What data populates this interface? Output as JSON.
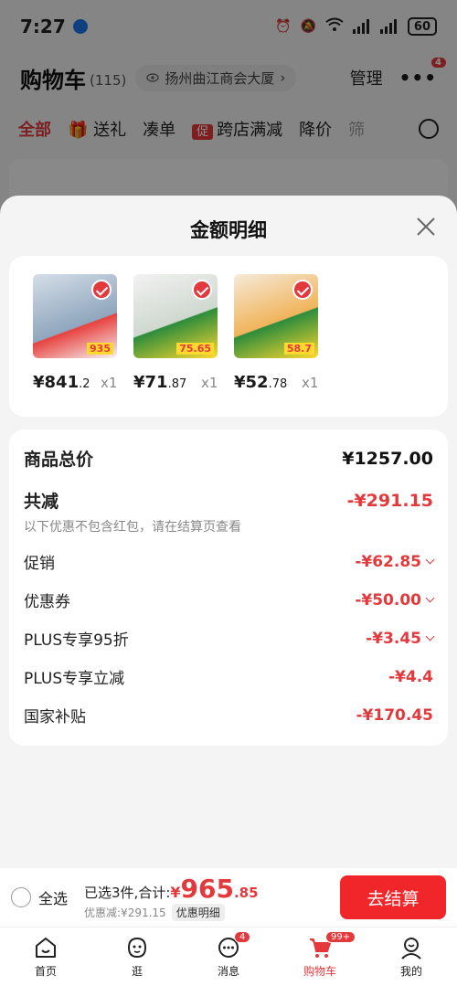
{
  "status_bar": {
    "time": "7:27",
    "battery": "60"
  },
  "header": {
    "title": "购物车",
    "count": "(115)",
    "address": "扬州曲江商会大厦",
    "manage": "管理",
    "notify_badge": "4"
  },
  "tabs": [
    {
      "label": "全部",
      "active": true
    },
    {
      "label": "送礼"
    },
    {
      "label": "凑单"
    },
    {
      "label": "跨店满减",
      "tag": "促"
    },
    {
      "label": "降价"
    },
    {
      "label": "筛"
    }
  ],
  "sheet": {
    "title": "金额明细",
    "products": [
      {
        "price_int": "¥841",
        "price_dec": ".2",
        "qty": "x1",
        "color": "#9fb4c7",
        "img_text": "935"
      },
      {
        "price_int": "¥71",
        "price_dec": ".87",
        "qty": "x1",
        "color": "#c7d6c0",
        "img_text": "75.65"
      },
      {
        "price_int": "¥52",
        "price_dec": ".78",
        "qty": "x1",
        "color": "#f0c98a",
        "img_text": "58.7"
      }
    ],
    "details": {
      "total_label": "商品总价",
      "total_value": "¥1257.00",
      "discount_label": "共减",
      "discount_value": "-¥291.15",
      "note": "以下优惠不包含红包，请在结算页查看",
      "items": [
        {
          "label": "促销",
          "value": "-¥62.85",
          "expandable": true
        },
        {
          "label": "优惠券",
          "value": "-¥50.00",
          "expandable": true
        },
        {
          "label": "PLUS专享95折",
          "value": "-¥3.45",
          "expandable": true
        },
        {
          "label": "PLUS专享立减",
          "value": "-¥4.4",
          "expandable": false
        },
        {
          "label": "国家补贴",
          "value": "-¥170.45",
          "expandable": false
        }
      ]
    }
  },
  "bottom_bar": {
    "select_all": "全选",
    "selected_text": "已选3件,合计:",
    "yen": "¥",
    "amount": "965",
    "decimal": ".85",
    "saved_text": "优惠减:¥291.15",
    "detail_chip": "优惠明细",
    "checkout": "去结算"
  },
  "tabbar": [
    {
      "label": "首页"
    },
    {
      "label": "逛"
    },
    {
      "label": "消息",
      "badge": "4"
    },
    {
      "label": "购物车",
      "badge": "99+",
      "active": true
    },
    {
      "label": "我的"
    }
  ],
  "colors": {
    "accent": "#e4393c",
    "checkout": "#f0262a"
  }
}
